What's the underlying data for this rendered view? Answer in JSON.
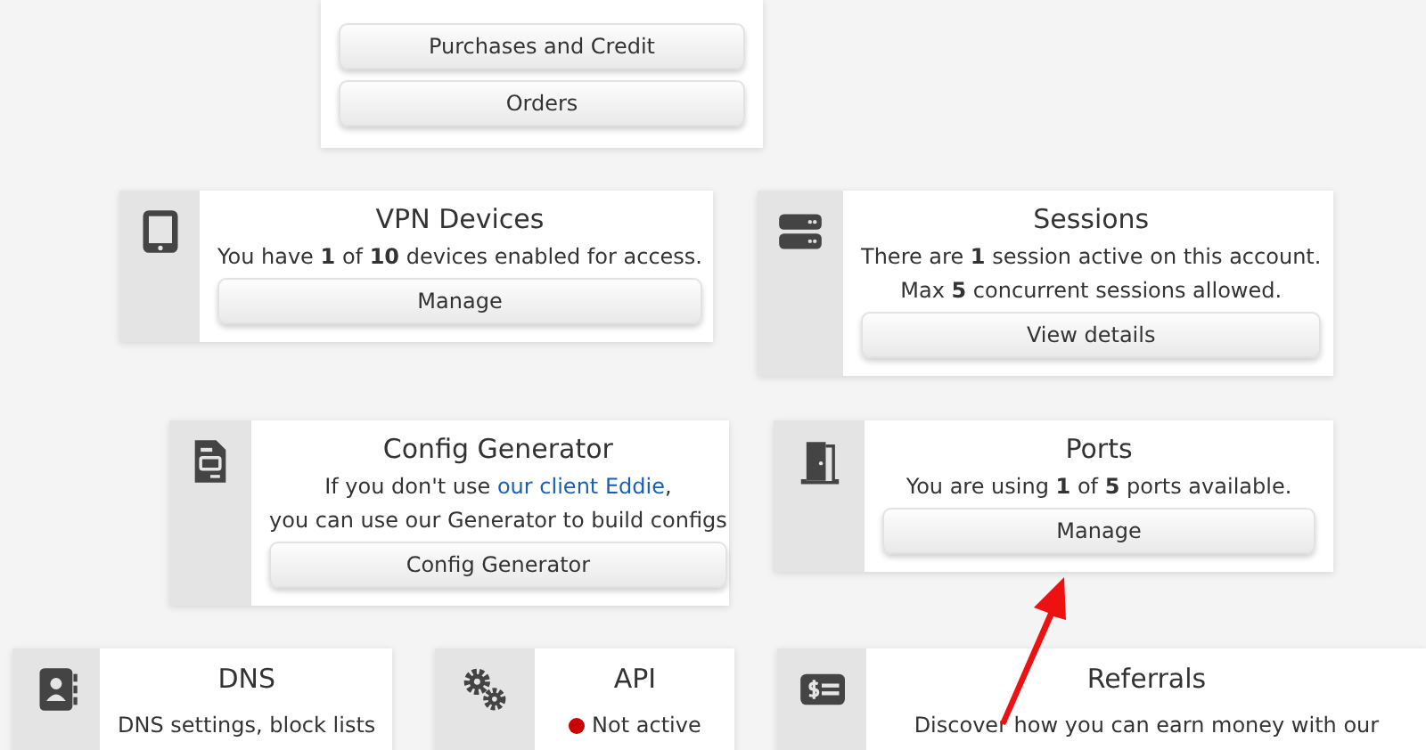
{
  "rows": [
    {
      "cards": [
        {
          "buttons": [
            "Purchases and Credit",
            "Orders"
          ]
        }
      ]
    },
    {
      "cards": [
        {
          "title": "VPN Devices",
          "lines": [
            [
              {
                "kind": "plain",
                "text": "You have "
              },
              {
                "kind": "bold",
                "text": "1"
              },
              {
                "kind": "plain",
                "text": " of "
              },
              {
                "kind": "bold",
                "text": "10"
              },
              {
                "kind": "plain",
                "text": " devices enabled for access."
              }
            ]
          ],
          "buttons": [
            "Manage"
          ]
        },
        {
          "title": "Sessions",
          "lines": [
            [
              {
                "kind": "plain",
                "text": "There are "
              },
              {
                "kind": "bold",
                "text": "1"
              },
              {
                "kind": "plain",
                "text": " session active on this account."
              }
            ],
            [
              {
                "kind": "plain",
                "text": "Max "
              },
              {
                "kind": "bold",
                "text": "5"
              },
              {
                "kind": "plain",
                "text": " concurrent sessions allowed."
              }
            ]
          ],
          "buttons": [
            "View details"
          ]
        }
      ]
    },
    {
      "cards": [
        {
          "title": "Config Generator",
          "lines": [
            [
              {
                "kind": "plain",
                "text": "If you don't use "
              },
              {
                "kind": "link",
                "text": "our client Eddie"
              },
              {
                "kind": "plain",
                "text": ","
              }
            ],
            [
              {
                "kind": "plain",
                "text": "you can use our Generator to build configs"
              }
            ]
          ],
          "buttons": [
            "Config Generator"
          ]
        },
        {
          "title": "Ports",
          "lines": [
            [
              {
                "kind": "plain",
                "text": "You are using "
              },
              {
                "kind": "bold",
                "text": "1"
              },
              {
                "kind": "plain",
                "text": " of "
              },
              {
                "kind": "bold",
                "text": "5"
              },
              {
                "kind": "plain",
                "text": " ports available."
              }
            ]
          ],
          "buttons": [
            "Manage"
          ]
        }
      ]
    },
    {
      "cards": [
        {
          "title": "DNS",
          "lines": [
            [
              {
                "kind": "plain",
                "text": "DNS settings, block lists"
              }
            ]
          ]
        },
        {
          "title": "API",
          "status": {
            "text": "Not active",
            "color": "#cc0000"
          }
        },
        {
          "title": "Referrals",
          "lines": [
            [
              {
                "kind": "plain",
                "text": "Discover how you can earn money with our"
              }
            ]
          ]
        }
      ]
    }
  ]
}
